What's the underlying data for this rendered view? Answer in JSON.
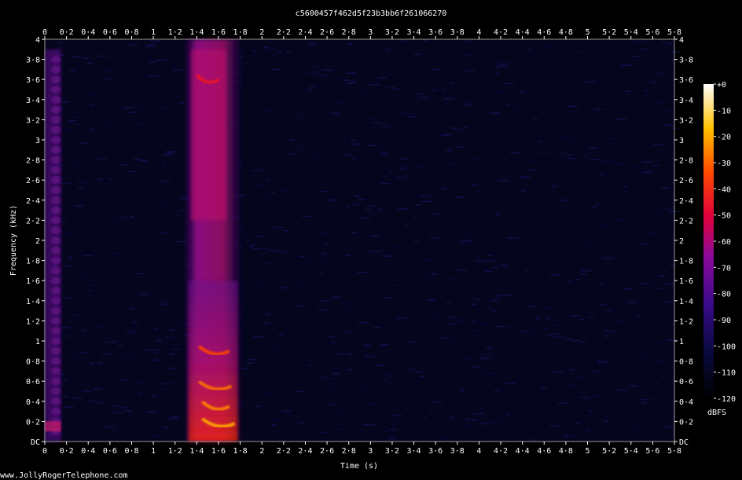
{
  "chart_data": {
    "type": "heatmap",
    "title": "c5600457f462d5f23b3bb6f261066270",
    "xlabel": "Time (s)",
    "ylabel": "Frequency (kHz)",
    "x_range": [
      0,
      5.8
    ],
    "y_range": [
      0,
      4
    ],
    "x_ticks": [
      "0",
      "0·2",
      "0·4",
      "0·6",
      "0·8",
      "1",
      "1·2",
      "1·4",
      "1·6",
      "1·8",
      "2",
      "2·2",
      "2·4",
      "2·6",
      "2·8",
      "3",
      "3·2",
      "3·4",
      "3·6",
      "3·8",
      "4",
      "4·2",
      "4·4",
      "4·6",
      "4·8",
      "5",
      "5·2",
      "5·4",
      "5·6",
      "5·8"
    ],
    "y_ticks": [
      "DC",
      "0·2",
      "0·4",
      "0·6",
      "0·8",
      "1",
      "1·2",
      "1·4",
      "1·6",
      "1·8",
      "2",
      "2·2",
      "2·4",
      "2·6",
      "2·8",
      "3",
      "3·2",
      "3·4",
      "3·6",
      "3·8",
      "4"
    ],
    "colorbar": {
      "unit": "dBFS",
      "range": [
        -120,
        0
      ],
      "ticks": [
        "+0",
        "-10",
        "-20",
        "-30",
        "-40",
        "-50",
        "-60",
        "-70",
        "-80",
        "-90",
        "-100",
        "-110",
        "-120"
      ]
    },
    "footer": "www.JollyRogerTelephone.com",
    "energy_regions": [
      {
        "t_start": 0.0,
        "t_end": 0.15,
        "f_start": 0.0,
        "f_end": 3.9,
        "level_db": -75
      },
      {
        "t_start": 1.3,
        "t_end": 1.8,
        "f_start": 0.0,
        "f_end": 4.0,
        "level_db": -45
      }
    ],
    "formants": [
      {
        "freq_khz": 0.18,
        "t_start": 1.45,
        "t_end": 1.75,
        "level_db": -20
      },
      {
        "freq_khz": 0.35,
        "t_start": 1.45,
        "t_end": 1.7,
        "level_db": -25
      },
      {
        "freq_khz": 0.55,
        "t_start": 1.42,
        "t_end": 1.72,
        "level_db": -28
      },
      {
        "freq_khz": 0.9,
        "t_start": 1.42,
        "t_end": 1.7,
        "level_db": -35
      },
      {
        "freq_khz": 3.6,
        "t_start": 1.4,
        "t_end": 1.6,
        "level_db": -45
      }
    ],
    "colors": {
      "background": "#000000",
      "axis": "#ffffff",
      "noise_floor": "#0a0a2a"
    }
  }
}
